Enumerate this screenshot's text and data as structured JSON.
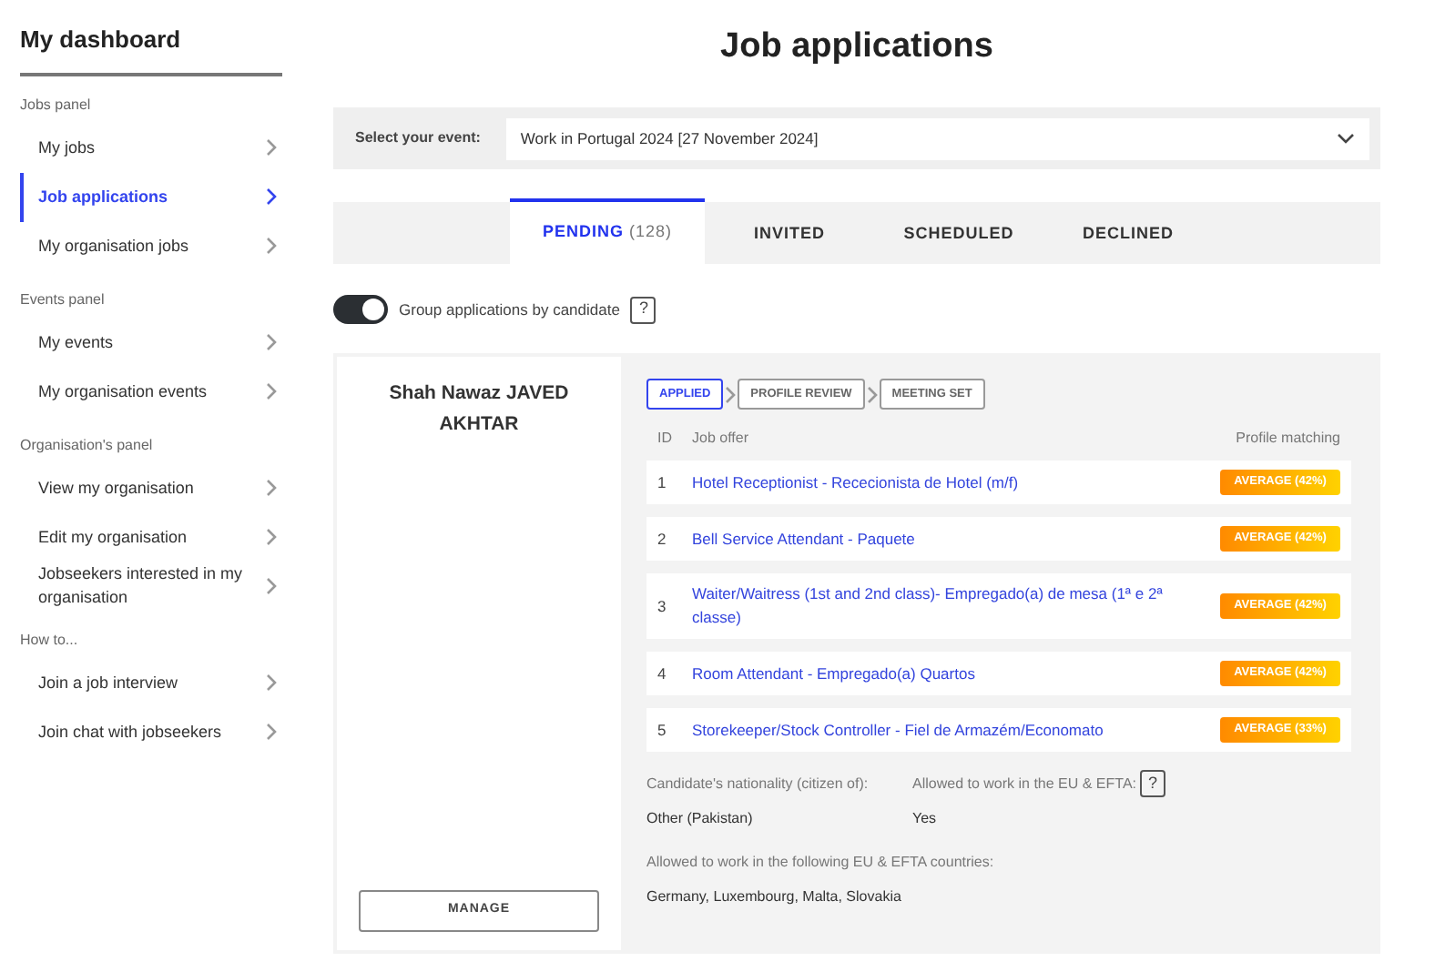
{
  "sidebar": {
    "title": "My dashboard",
    "sections": [
      {
        "heading": "Jobs panel",
        "items": [
          {
            "label": "My jobs",
            "selected": false
          },
          {
            "label": "Job applications",
            "selected": true
          },
          {
            "label": "My organisation jobs",
            "selected": false
          }
        ]
      },
      {
        "heading": "Events panel",
        "items": [
          {
            "label": "My events",
            "selected": false
          },
          {
            "label": "My organisation events",
            "selected": false
          }
        ]
      },
      {
        "heading": "Organisation's panel",
        "items": [
          {
            "label": "View my organisation",
            "selected": false
          },
          {
            "label": "Edit my organisation",
            "selected": false
          },
          {
            "label": "Jobseekers interested in my organisation",
            "selected": false
          }
        ]
      },
      {
        "heading": "How to...",
        "items": [
          {
            "label": "Join a job interview",
            "selected": false
          },
          {
            "label": "Join chat with jobseekers",
            "selected": false
          }
        ]
      }
    ]
  },
  "page_title": "Job applications",
  "event_select": {
    "label": "Select your event:",
    "value": "Work in Portugal 2024 [27 November 2024]"
  },
  "tabs": [
    {
      "label": "PENDING",
      "count": "(128)",
      "selected": true
    },
    {
      "label": "INVITED",
      "selected": false
    },
    {
      "label": "SCHEDULED",
      "selected": false
    },
    {
      "label": "DECLINED",
      "selected": false
    }
  ],
  "group_toggle": {
    "label": "Group applications by candidate",
    "on": true,
    "help": "?"
  },
  "candidate": {
    "name": "Shah Nawaz JAVED AKHTAR",
    "manage_button": "MANAGE",
    "stages": [
      {
        "label": "APPLIED",
        "selected": true
      },
      {
        "label": "PROFILE REVIEW",
        "selected": false
      },
      {
        "label": "MEETING SET",
        "selected": false
      }
    ],
    "columns": [
      "ID",
      "Job offer",
      "Profile matching"
    ],
    "rows": [
      {
        "id": "1",
        "job_offer": "Hotel Receptionist - Rececionista de Hotel (m/f)",
        "matching": "AVERAGE (42%)"
      },
      {
        "id": "2",
        "job_offer": "Bell Service Attendant - Paquete",
        "matching": "AVERAGE (42%)"
      },
      {
        "id": "3",
        "job_offer": "Waiter/Waitress (1st and 2nd class)- Empregado(a) de mesa (1ª e 2ª classe)",
        "matching": "AVERAGE (42%)"
      },
      {
        "id": "4",
        "job_offer": "Room Attendant - Empregado(a) Quartos",
        "matching": "AVERAGE (42%)"
      },
      {
        "id": "5",
        "job_offer": "Storekeeper/Stock Controller - Fiel de Armazém/Economato",
        "matching": "AVERAGE (33%)"
      }
    ],
    "nationality": {
      "label": "Candidate's nationality (citizen of):",
      "value": "Other (Pakistan)"
    },
    "allowed": {
      "label": "Allowed to work in the EU & EFTA:",
      "help": "?",
      "value": "Yes"
    },
    "countries": {
      "label": "Allowed to work in the following EU & EFTA countries:",
      "value": "Germany, Luxembourg, Malta, Slovakia"
    }
  }
}
